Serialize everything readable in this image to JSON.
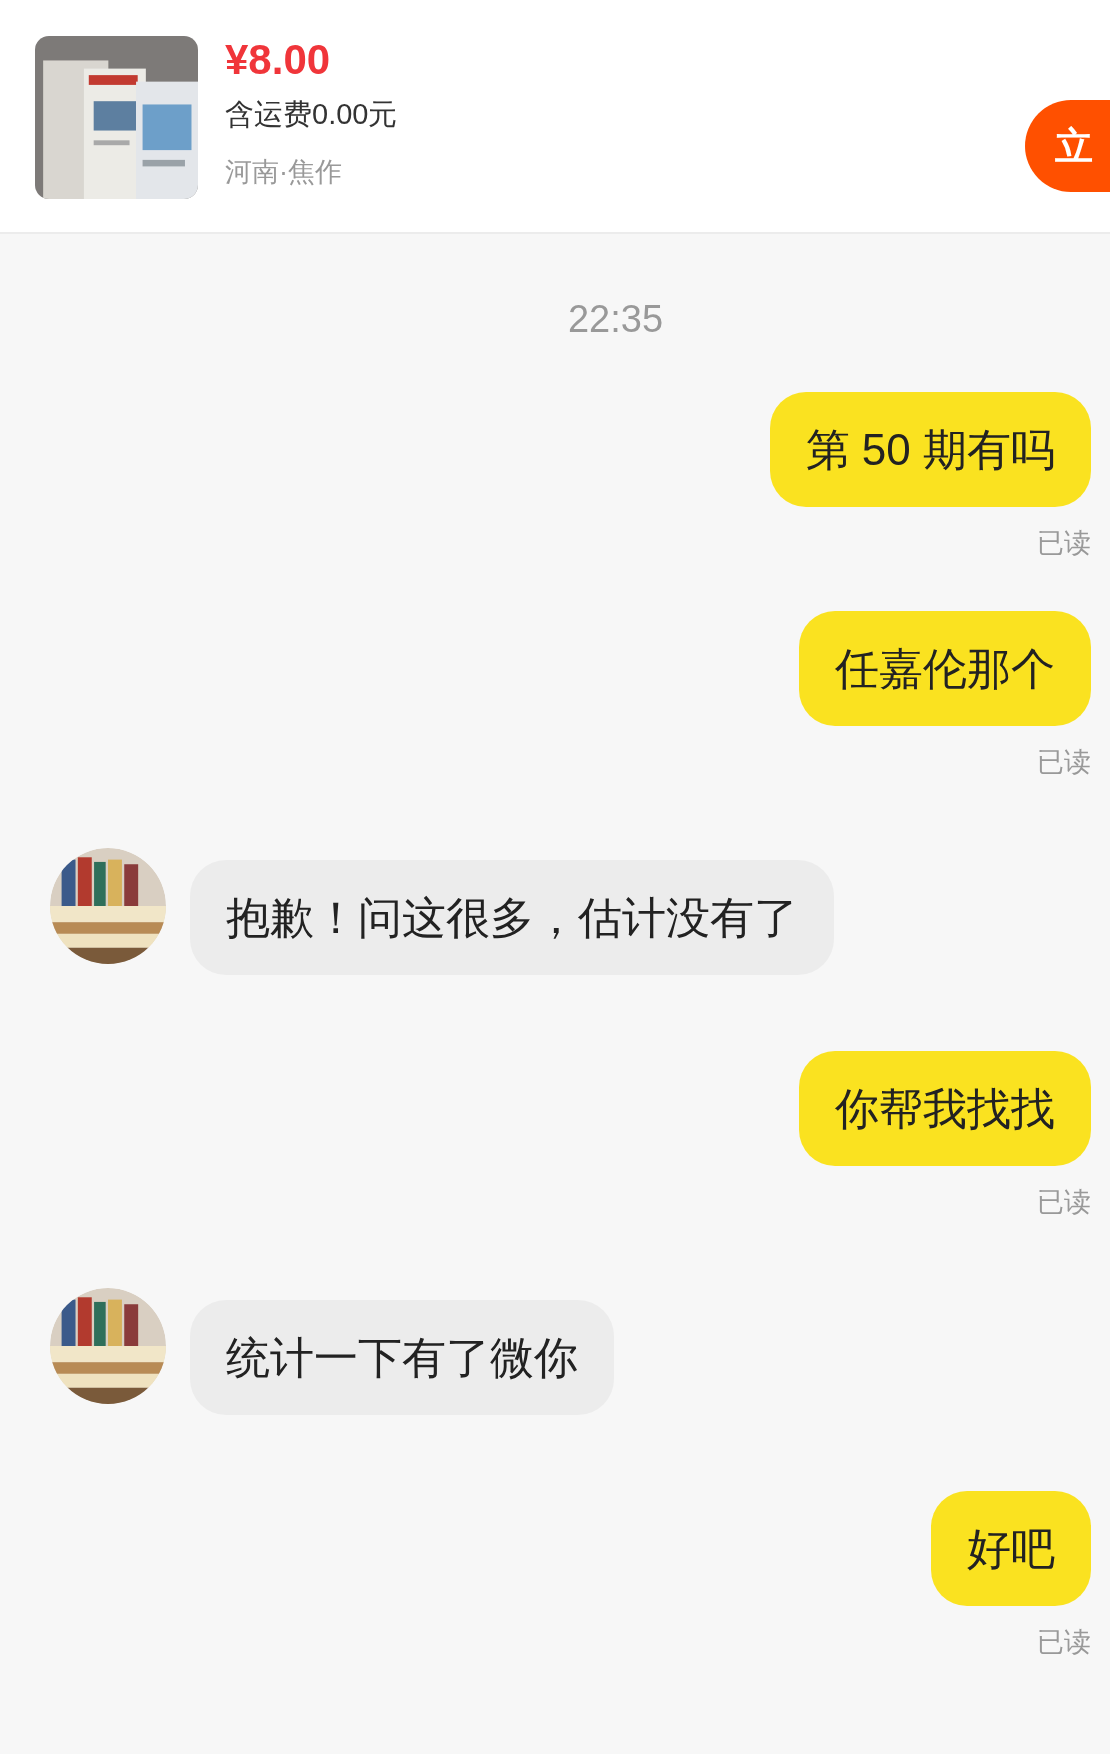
{
  "product": {
    "kind": "picture",
    "price": "¥8.00",
    "shipping": "含运费0.00元",
    "location": "河南·焦作",
    "buy_button": "立"
  },
  "messages": [
    {
      "kind": "time",
      "text": "22:35"
    },
    {
      "kind": "sent",
      "text": "第 50 期有吗",
      "receipt": "已读"
    },
    {
      "kind": "sent",
      "text": "任嘉伦那个",
      "receipt": "已读"
    },
    {
      "kind": "received",
      "text": "抱歉！问这很多，估计没有了"
    },
    {
      "kind": "sent",
      "text": "你帮我找找",
      "receipt": "已读"
    },
    {
      "kind": "received",
      "text": "统计一下有了微你"
    },
    {
      "kind": "sent",
      "text": "好吧",
      "receipt": "已读"
    }
  ]
}
